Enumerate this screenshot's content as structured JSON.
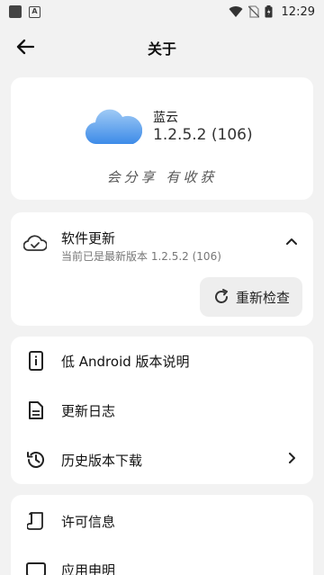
{
  "status_bar": {
    "time": "12:29"
  },
  "app_bar": {
    "title": "关于"
  },
  "app_info": {
    "name": "蓝云",
    "version": "1.2.5.2 (106)",
    "slogan": "会分享 有收获"
  },
  "update": {
    "title": "软件更新",
    "subtitle": "当前已是最新版本 1.2.5.2 (106)",
    "recheck_label": "重新检查"
  },
  "links": {
    "items": [
      {
        "label": "低 Android 版本说明",
        "icon": "phone-info-icon"
      },
      {
        "label": "更新日志",
        "icon": "document-icon"
      },
      {
        "label": "历史版本下载",
        "icon": "history-icon"
      }
    ]
  },
  "legal": {
    "items": [
      {
        "label": "许可信息",
        "icon": "scroll-icon"
      },
      {
        "label": "应用申明",
        "icon": "card-icon"
      }
    ]
  }
}
